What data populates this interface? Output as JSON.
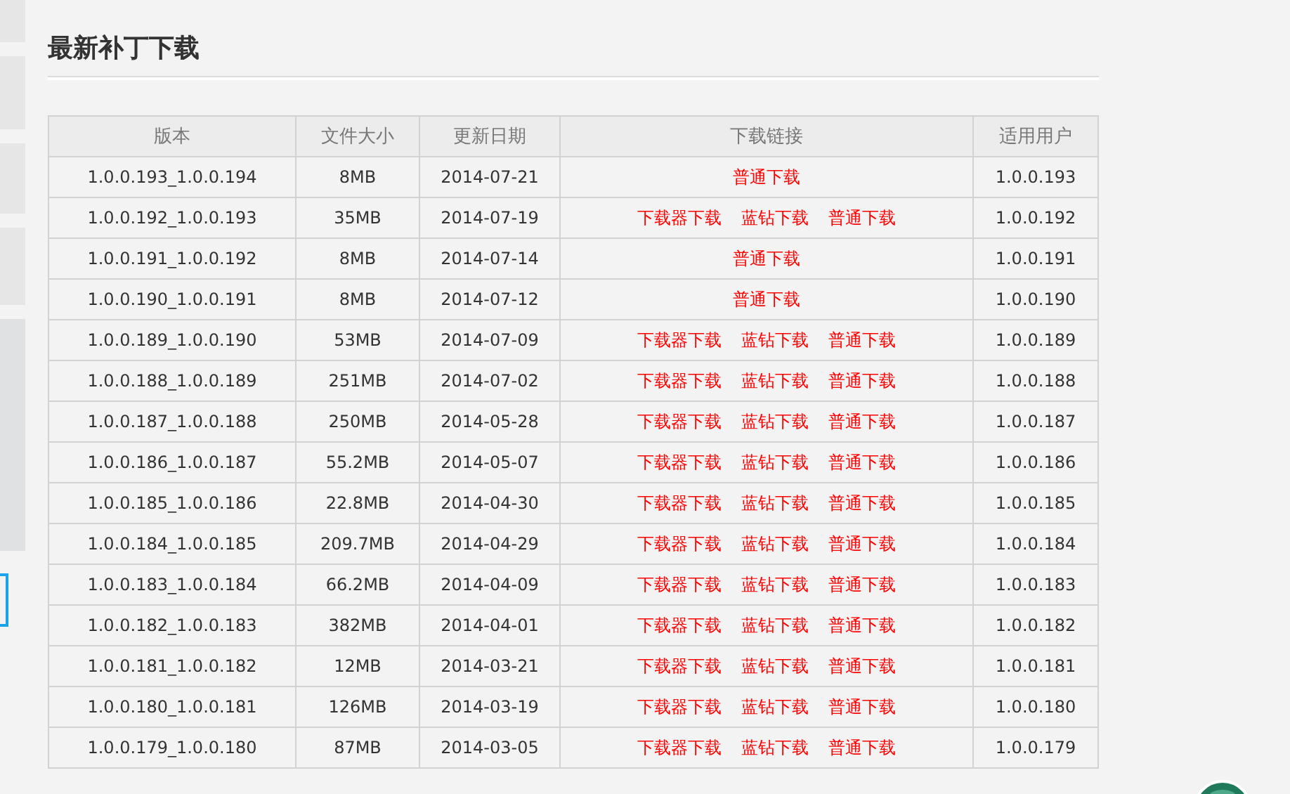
{
  "title": "最新补丁下载",
  "table": {
    "columns": [
      "版本",
      "文件大小",
      "更新日期",
      "下载链接",
      "适用用户"
    ],
    "rows": [
      {
        "version": "1.0.0.193_1.0.0.194",
        "size": "8MB",
        "date": "2014-07-21",
        "links": [
          "普通下载"
        ],
        "user": "1.0.0.193"
      },
      {
        "version": "1.0.0.192_1.0.0.193",
        "size": "35MB",
        "date": "2014-07-19",
        "links": [
          "下载器下载",
          "蓝钻下载",
          "普通下载"
        ],
        "user": "1.0.0.192"
      },
      {
        "version": "1.0.0.191_1.0.0.192",
        "size": "8MB",
        "date": "2014-07-14",
        "links": [
          "普通下载"
        ],
        "user": "1.0.0.191"
      },
      {
        "version": "1.0.0.190_1.0.0.191",
        "size": "8MB",
        "date": "2014-07-12",
        "links": [
          "普通下载"
        ],
        "user": "1.0.0.190"
      },
      {
        "version": "1.0.0.189_1.0.0.190",
        "size": "53MB",
        "date": "2014-07-09",
        "links": [
          "下载器下载",
          "蓝钻下载",
          "普通下载"
        ],
        "user": "1.0.0.189"
      },
      {
        "version": "1.0.0.188_1.0.0.189",
        "size": "251MB",
        "date": "2014-07-02",
        "links": [
          "下载器下载",
          "蓝钻下载",
          "普通下载"
        ],
        "user": "1.0.0.188"
      },
      {
        "version": "1.0.0.187_1.0.0.188",
        "size": "250MB",
        "date": "2014-05-28",
        "links": [
          "下载器下载",
          "蓝钻下载",
          "普通下载"
        ],
        "user": "1.0.0.187"
      },
      {
        "version": "1.0.0.186_1.0.0.187",
        "size": "55.2MB",
        "date": "2014-05-07",
        "links": [
          "下载器下载",
          "蓝钻下载",
          "普通下载"
        ],
        "user": "1.0.0.186"
      },
      {
        "version": "1.0.0.185_1.0.0.186",
        "size": "22.8MB",
        "date": "2014-04-30",
        "links": [
          "下载器下载",
          "蓝钻下载",
          "普通下载"
        ],
        "user": "1.0.0.185"
      },
      {
        "version": "1.0.0.184_1.0.0.185",
        "size": "209.7MB",
        "date": "2014-04-29",
        "links": [
          "下载器下载",
          "蓝钻下载",
          "普通下载"
        ],
        "user": "1.0.0.184"
      },
      {
        "version": "1.0.0.183_1.0.0.184",
        "size": "66.2MB",
        "date": "2014-04-09",
        "links": [
          "下载器下载",
          "蓝钻下载",
          "普通下载"
        ],
        "user": "1.0.0.183"
      },
      {
        "version": "1.0.0.182_1.0.0.183",
        "size": "382MB",
        "date": "2014-04-01",
        "links": [
          "下载器下载",
          "蓝钻下载",
          "普通下载"
        ],
        "user": "1.0.0.182"
      },
      {
        "version": "1.0.0.181_1.0.0.182",
        "size": "12MB",
        "date": "2014-03-21",
        "links": [
          "下载器下载",
          "蓝钻下载",
          "普通下载"
        ],
        "user": "1.0.0.181"
      },
      {
        "version": "1.0.0.180_1.0.0.181",
        "size": "126MB",
        "date": "2014-03-19",
        "links": [
          "下载器下载",
          "蓝钻下载",
          "普通下载"
        ],
        "user": "1.0.0.180"
      },
      {
        "version": "1.0.0.179_1.0.0.180",
        "size": "87MB",
        "date": "2014-03-05",
        "links": [
          "下载器下载",
          "蓝钻下载",
          "普通下载"
        ],
        "user": "1.0.0.179"
      }
    ]
  }
}
